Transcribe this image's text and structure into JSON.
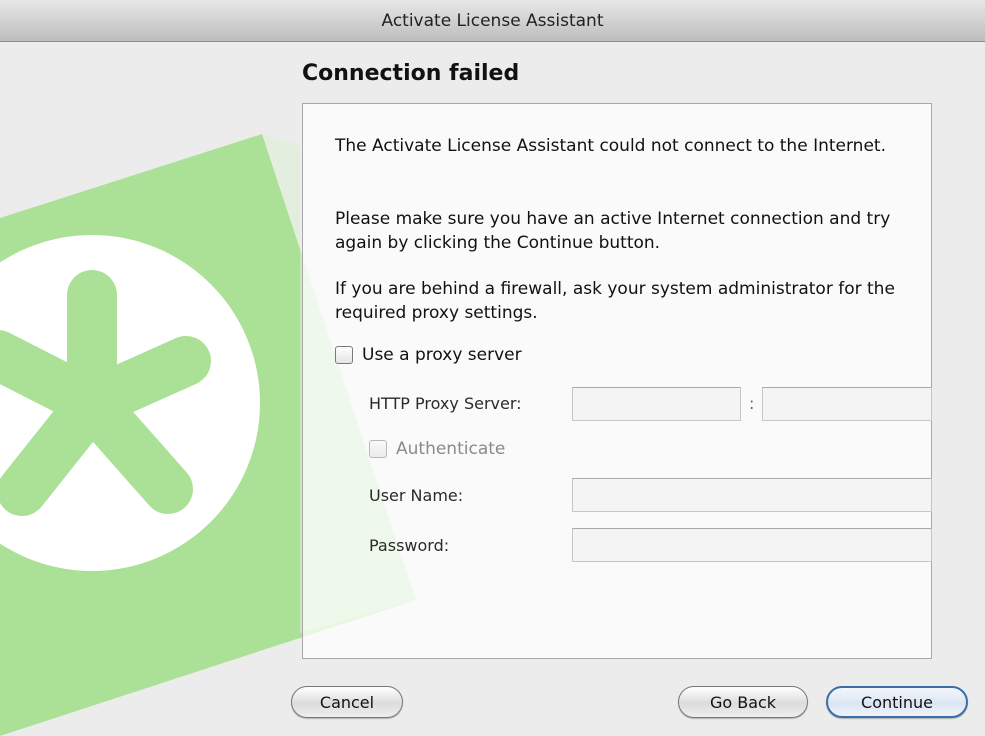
{
  "window": {
    "title": "Activate License Assistant"
  },
  "page": {
    "heading": "Connection failed"
  },
  "messages": [
    "The Activate License Assistant could not connect to the Internet.",
    "Please make sure you have an active Internet connection and try again by clicking the Continue button.",
    "If you are behind a firewall, ask your system administrator for the required proxy settings."
  ],
  "proxy": {
    "use_proxy_label": "Use a proxy server",
    "use_proxy_checked": false,
    "http_proxy_label": "HTTP Proxy Server:",
    "host_value": "",
    "port_separator": ":",
    "port_value": "",
    "authenticate_label": "Authenticate",
    "authenticate_checked": false,
    "authenticate_enabled": false,
    "username_label": "User Name:",
    "username_value": "",
    "password_label": "Password:",
    "password_value": ""
  },
  "buttons": {
    "cancel": "Cancel",
    "go_back": "Go Back",
    "continue": "Continue"
  },
  "colors": {
    "logo_green": "#abe196",
    "default_button_border": "#3b6ea8",
    "background": "#ececec"
  }
}
